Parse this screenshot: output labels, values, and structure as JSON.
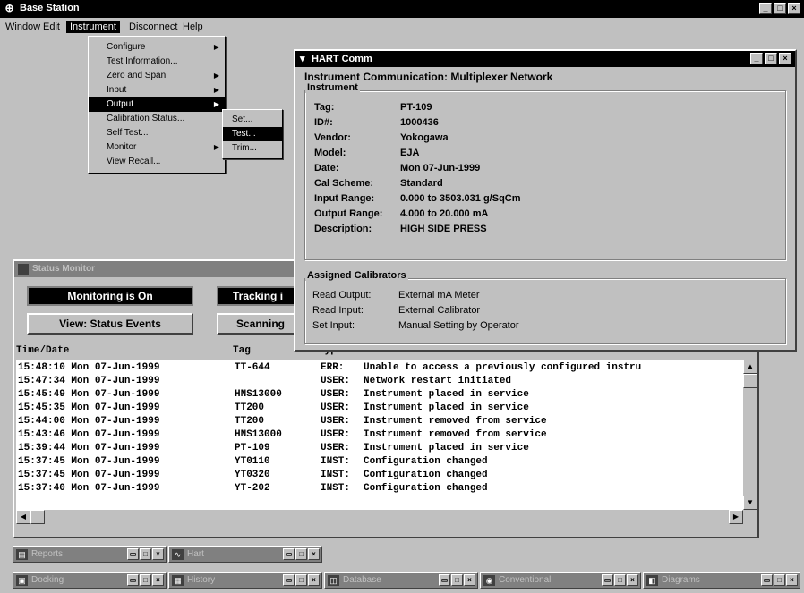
{
  "app": {
    "title": "Base Station",
    "icon": "antenna-icon",
    "controls": [
      "_",
      "□",
      "×"
    ]
  },
  "menubar": {
    "items": [
      "Window",
      "Edit",
      "Instrument",
      "Disconnect",
      "Help"
    ]
  },
  "instrument_menu": {
    "items": [
      {
        "label": "Configure",
        "submenu": true
      },
      {
        "label": "Test Information..."
      },
      {
        "label": "Zero and Span",
        "submenu": true
      },
      {
        "label": "Input",
        "submenu": true
      },
      {
        "label": "Output",
        "submenu": true
      },
      {
        "label": "Calibration Status..."
      },
      {
        "label": "Self Test..."
      },
      {
        "label": "Monitor",
        "submenu": true
      },
      {
        "label": "View Recall..."
      }
    ],
    "output_submenu": [
      "Set...",
      "Test...",
      "Trim..."
    ]
  },
  "hart": {
    "title": "HART Comm",
    "heading": "Instrument Communication: Multiplexer Network",
    "instrument_group": "Instrument",
    "fields": [
      {
        "key": "Tag:",
        "value": "PT-109"
      },
      {
        "key": "ID#:",
        "value": "1000436"
      },
      {
        "key": "Vendor:",
        "value": "Yokogawa"
      },
      {
        "key": "Model:",
        "value": "EJA"
      },
      {
        "key": "Date:",
        "value": "Mon 07-Jun-1999"
      },
      {
        "key": "Cal Scheme:",
        "value": "Standard"
      },
      {
        "key": "Input Range:",
        "value": "0.000 to 3503.031 g/SqCm"
      },
      {
        "key": "Output Range:",
        "value": "4.000 to 20.000 mA"
      },
      {
        "key": "Description:",
        "value": "HIGH SIDE PRESS"
      }
    ],
    "calibrators_group": "Assigned Calibrators",
    "calibrators": [
      {
        "key": "Read Output:",
        "value": "External mA Meter"
      },
      {
        "key": "Read Input:",
        "value": "External Calibrator"
      },
      {
        "key": "Set Input:",
        "value": "Manual Setting by Operator"
      }
    ]
  },
  "status": {
    "title": "Status Monitor",
    "monitoring": "Monitoring is On",
    "tracking": "Tracking i",
    "view": "View: Status Events",
    "scanning": "Scanning",
    "headers": {
      "time": "Time/Date",
      "tag": "Tag",
      "type": "Type"
    },
    "rows": [
      {
        "time": "15:48:10 Mon 07-Jun-1999",
        "tag": "TT-644",
        "type": "ERR:",
        "event": "Unable to access a previously configured instru"
      },
      {
        "time": "15:47:34 Mon 07-Jun-1999",
        "tag": "",
        "type": "USER:",
        "event": "Network restart initiated"
      },
      {
        "time": "15:45:49 Mon 07-Jun-1999",
        "tag": "HNS13000",
        "type": "USER:",
        "event": "Instrument placed in service"
      },
      {
        "time": "15:45:35 Mon 07-Jun-1999",
        "tag": "TT200",
        "type": "USER:",
        "event": "Instrument placed in service"
      },
      {
        "time": "15:44:00 Mon 07-Jun-1999",
        "tag": "TT200",
        "type": "USER:",
        "event": "Instrument removed from service"
      },
      {
        "time": "15:43:46 Mon 07-Jun-1999",
        "tag": "HNS13000",
        "type": "USER:",
        "event": "Instrument removed from service"
      },
      {
        "time": "15:39:44 Mon 07-Jun-1999",
        "tag": "PT-109",
        "type": "USER:",
        "event": "Instrument placed in service"
      },
      {
        "time": "15:37:45 Mon 07-Jun-1999",
        "tag": "YT0110",
        "type": "INST:",
        "event": "Configuration changed"
      },
      {
        "time": "15:37:45 Mon 07-Jun-1999",
        "tag": "YT0320",
        "type": "INST:",
        "event": "Configuration changed"
      },
      {
        "time": "15:37:40 Mon 07-Jun-1999",
        "tag": "YT-202",
        "type": "INST:",
        "event": "Configuration changed"
      }
    ]
  },
  "minimized": [
    {
      "label": "Reports",
      "icon": "reports-icon"
    },
    {
      "label": "Hart",
      "icon": "hart-icon"
    },
    {
      "label": "Docking",
      "icon": "docking-icon"
    },
    {
      "label": "History",
      "icon": "history-icon"
    },
    {
      "label": "Database",
      "icon": "database-icon"
    },
    {
      "label": "Conventional",
      "icon": "conventional-icon"
    },
    {
      "label": "Diagrams",
      "icon": "diagrams-icon"
    }
  ]
}
